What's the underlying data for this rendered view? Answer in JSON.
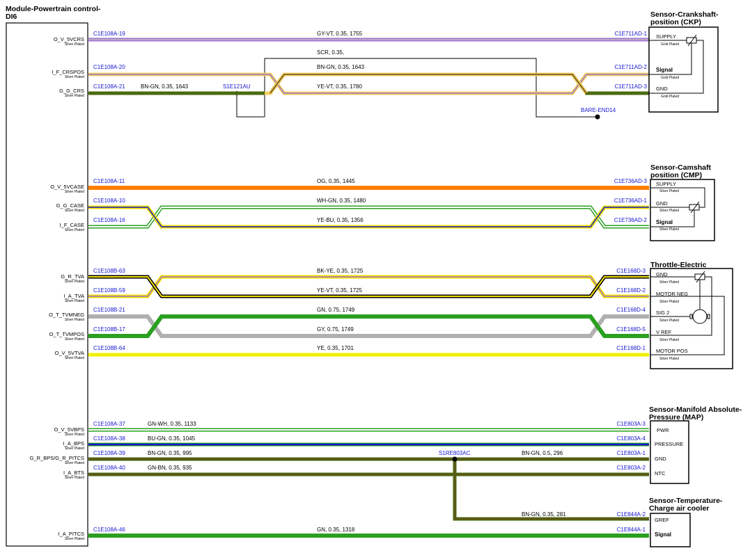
{
  "module": {
    "title_line1": "Module-Powertrain control-",
    "title_line2": "DI6",
    "pins": [
      {
        "name": "O_V_5VCRS",
        "plating": "Silver Plated"
      },
      {
        "name": "I_F_CRSPOS",
        "plating": "Silver Plated"
      },
      {
        "name": "G_G_CRS",
        "plating": "Silver Plated"
      },
      {
        "name": "O_V_5VCASE",
        "plating": "Silver Plated"
      },
      {
        "name": "G_G_CASE",
        "plating": "Silver Plated"
      },
      {
        "name": "I_F_CASE",
        "plating": "Silver Plated"
      },
      {
        "name": "G_R_TVA",
        "plating": "Silver Plated"
      },
      {
        "name": "I_A_TVA",
        "plating": "Silver Plated"
      },
      {
        "name": "O_T_TVMNEG",
        "plating": "Silver Plated"
      },
      {
        "name": "O_T_TVMPOS",
        "plating": "Silver Plated"
      },
      {
        "name": "O_V_5VTVA",
        "plating": "Silver Plated"
      },
      {
        "name": "O_V_5VBPS",
        "plating": "Silver Plated"
      },
      {
        "name": "I_A_BPS",
        "plating": "Silver Plated"
      },
      {
        "name": "G_R_BPS/G_R_PITCS",
        "plating": "Silver Plated"
      },
      {
        "name": "I_A_BTS",
        "plating": "Silver Plated"
      },
      {
        "name": "I_A_PITCS",
        "plating": "Silver Plated"
      }
    ]
  },
  "components": [
    {
      "title_line1": "Sensor-Crankshaft-",
      "title_line2": "position (CKP)",
      "pins": [
        {
          "name": "SUPPLY",
          "plating": "Gold Plated"
        },
        {
          "name": "Signal",
          "plating": "Gold Plated"
        },
        {
          "name": "GND",
          "plating": "Gold Plated"
        }
      ]
    },
    {
      "title_line1": "Sensor-Camshaft",
      "title_line2": "position (CMP)",
      "pins": [
        {
          "name": "SUPPLY",
          "plating": "Silver Plated"
        },
        {
          "name": "GND",
          "plating": "Silver Plated"
        },
        {
          "name": "Signal",
          "plating": "Silver Plated"
        }
      ]
    },
    {
      "title_line1": "Throttle-Electric",
      "title_line2": "",
      "pins": [
        {
          "name": "GND",
          "plating": "Silver Plated"
        },
        {
          "name": "MOTOR NEG",
          "plating": "Silver Plated"
        },
        {
          "name": "SIG 2",
          "plating": "Silver Plated"
        },
        {
          "name": "V REF",
          "plating": "Silver Plated"
        },
        {
          "name": "MOTOR POS",
          "plating": "Silver Plated"
        }
      ]
    },
    {
      "title_line1": "Sensor-Manifold Absolute-",
      "title_line2": "Pressure (MAP)",
      "pins": [
        {
          "name": "PWR"
        },
        {
          "name": "PRESSURE"
        },
        {
          "name": "GND"
        },
        {
          "name": "NTC"
        }
      ]
    },
    {
      "title_line1": "Sensor-Temperature-",
      "title_line2": "Charge air cooler",
      "pins": [
        {
          "name": "GREF"
        },
        {
          "name": "Signal"
        }
      ]
    }
  ],
  "wires": [
    {
      "from": "C1E108A-19",
      "to": "C1E711AD-1",
      "label": "GY-VT,  0.35,  1755",
      "color": "#a070d0"
    },
    {
      "from": "C1E108A-20",
      "to": "C1E711AD-2",
      "label": "BN-GN,  0.35,  1643",
      "color": "#6b4a1a"
    },
    {
      "from": "C1E108A-21",
      "to": "C1E711AD-3",
      "label": "YE-VT,  0.35,  1780",
      "color": "#f0e000"
    },
    {
      "from": "C1E108A-11",
      "to": "C1E736AD-3",
      "label": "OG,  0.35,  1445",
      "color": "#ff8000"
    },
    {
      "from": "C1E108A-10",
      "to": "C1E736AD-1",
      "label": "WH-GN,  0.35,  1480",
      "color": "#ffffff"
    },
    {
      "from": "C1E108A-16",
      "to": "C1E736AD-2",
      "label": "YE-BU,  0.35,  1356",
      "color": "#f0e000"
    },
    {
      "from": "C1E108B-63",
      "to": "C1E168D-3",
      "label": "BK-YE,  0.35,  1725",
      "color": "#000000"
    },
    {
      "from": "C1E108B-59",
      "to": "C1E168D-2",
      "label": "YE-VT,  0.35,  1725",
      "color": "#f0e000"
    },
    {
      "from": "C1E108B-21",
      "to": "C1E168D-4",
      "label": "GN,  0.75,  1749",
      "color": "#2aa020"
    },
    {
      "from": "C1E108B-17",
      "to": "C1E168D-5",
      "label": "GY,  0.75,  1749",
      "color": "#b0b0b0"
    },
    {
      "from": "C1E108B-64",
      "to": "C1E168D-1",
      "label": "YE,  0.35,  1701",
      "color": "#f0f000"
    },
    {
      "from": "C1E108A-37",
      "to": "C1E803A-3",
      "label": "GN-WH,  0.35,  1133",
      "color": "#2aa020"
    },
    {
      "from": "C1E108A-38",
      "to": "C1E803A-4",
      "label": "BU-GN,  0.35,  1045",
      "color": "#1414d2"
    },
    {
      "from": "C1E108A-39",
      "to": "C1E803A-1",
      "label": "BN-GN,  0.35,  995",
      "label2": "BN-GN,  0.5,  296",
      "color": "#6b4a1a"
    },
    {
      "from": "C1E108A-40",
      "to": "C1E803A-2",
      "label": "GN-BN,  0.35,  935",
      "color": "#2aa020"
    },
    {
      "from": "",
      "to": "C1E844A-2",
      "label": "BN-GN,  0.35,  281",
      "color": "#6b4a1a"
    },
    {
      "from": "C1E108A-46",
      "to": "C1E844A-1",
      "label": "GN,  0.35,  1318",
      "color": "#2aa020"
    }
  ],
  "extras": {
    "shield_label": "SCR,  0.35,",
    "bare_end": "BARE-END14",
    "splice_ckp": "S1E121AU",
    "ckp_gnd_wire": "BN-GN,  0.35,  1643",
    "splice_map": "S1RE803AC"
  },
  "colors": {
    "connector_text": "#1414d2",
    "green": "#2aa020",
    "brown_green": "#4a6a10",
    "orange": "#ff8000",
    "yellow": "#f0f000",
    "grey": "#b0b0b0",
    "violet": "#a070d0",
    "blue": "#1414d2"
  }
}
